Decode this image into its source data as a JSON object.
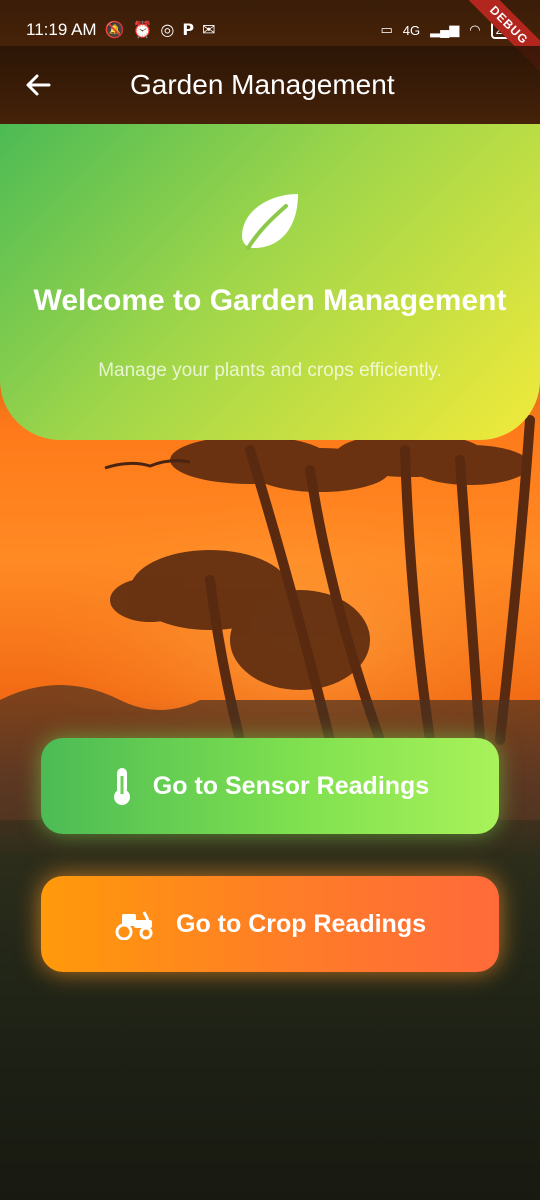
{
  "status_bar": {
    "time": "11:19 AM",
    "network": "4G",
    "battery": "26",
    "debug_label": "DEBUG"
  },
  "appbar": {
    "title": "Garden Management",
    "back_icon": "arrow-left-icon"
  },
  "welcome": {
    "icon": "leaf-icon",
    "title": "Welcome to Garden Management",
    "subtitle": "Manage your plants and crops efficiently."
  },
  "buttons": [
    {
      "label": "Go to Sensor Readings",
      "icon": "thermometer-icon",
      "color_start": "#4cbb55",
      "color_end": "#a8f25a"
    },
    {
      "label": "Go to Crop Readings",
      "icon": "tractor-icon",
      "color_start": "#ff9a0a",
      "color_end": "#ff6a3a"
    }
  ]
}
